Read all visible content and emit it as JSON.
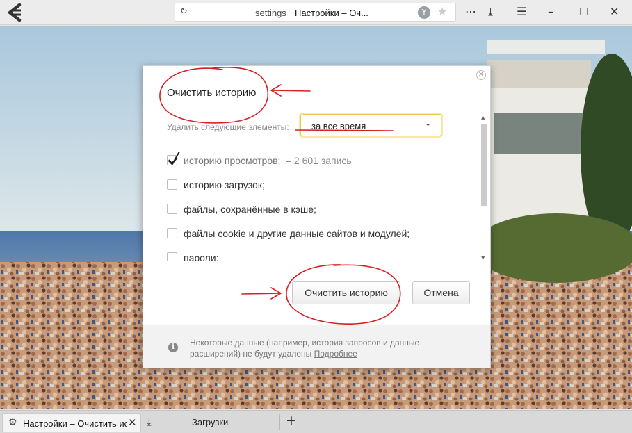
{
  "browser": {
    "url_text": "settings",
    "page_title": "Настройки – Оч...",
    "proto_icon": "yandex-protect-icon",
    "star_icon": "bookmark-star-icon"
  },
  "dialog": {
    "title": "Очистить историю",
    "range_label": "Удалить следующие элементы:",
    "range_value": "за все время",
    "items": [
      {
        "label": "историю просмотров;",
        "count": "– 2 601 запись",
        "checked": true
      },
      {
        "label": "историю загрузок;",
        "count": "",
        "checked": false
      },
      {
        "label": "файлы, сохранённые в кэше;",
        "count": "",
        "checked": false
      },
      {
        "label": "файлы cookie и другие данные сайтов и модулей;",
        "count": "",
        "checked": false
      },
      {
        "label": "пароли;",
        "count": "",
        "checked": false
      }
    ],
    "clear_button": "Очистить историю",
    "cancel_button": "Отмена",
    "note": "Некоторые данные (например, история запросов и данные расширений) не будут удалены",
    "note_link": "Подробнее"
  },
  "tabs": {
    "active_title": "Настройки – Очистить ис",
    "downloads": "Загрузки"
  },
  "colors": {
    "annotation": "#d81f26",
    "select_highlight": "#f0c850"
  }
}
